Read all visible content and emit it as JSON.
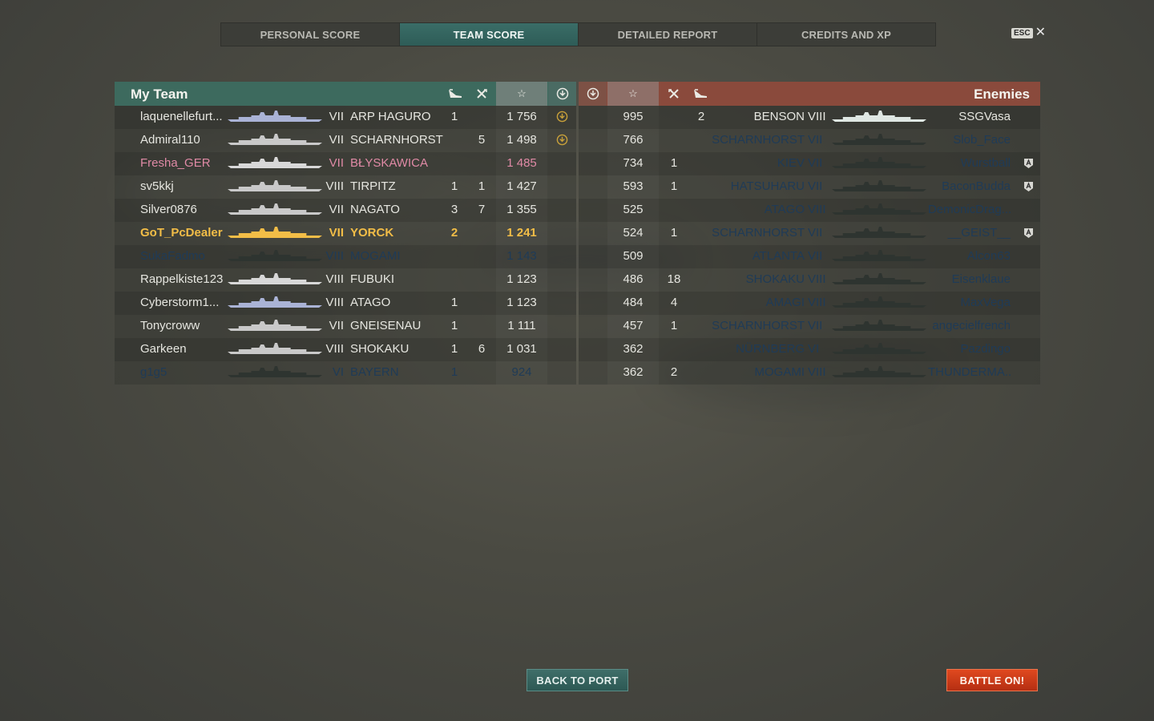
{
  "tabs": [
    {
      "label": "PERSONAL SCORE"
    },
    {
      "label": "TEAM SCORE"
    },
    {
      "label": "DETAILED REPORT"
    },
    {
      "label": "CREDITS AND XP"
    }
  ],
  "esc": {
    "key": "ESC",
    "close": "✕"
  },
  "my_team": {
    "title": "My Team",
    "rows": [
      {
        "player": "laquenellefurt...",
        "tier": "VII",
        "ship": "ARP HAGURO",
        "planes": "1",
        "ships": "",
        "xp": "1 756",
        "state": "normal",
        "medal": true,
        "hull": "#aab3d6"
      },
      {
        "player": "Admiral110",
        "tier": "VII",
        "ship": "SCHARNHORST",
        "planes": "",
        "ships": "5",
        "xp": "1 498",
        "state": "normal",
        "medal": true,
        "hull": "#c9c9c9"
      },
      {
        "player": "Fresha_GER",
        "tier": "VII",
        "ship": "BŁYSKAWICA",
        "planes": "",
        "ships": "",
        "xp": "1 485",
        "state": "pink",
        "medal": false,
        "hull": "#d8d8d8"
      },
      {
        "player": "sv5kkj",
        "tier": "VIII",
        "ship": "TIRPITZ",
        "planes": "1",
        "ships": "1",
        "xp": "1 427",
        "state": "normal",
        "medal": false,
        "hull": "#c9c9c9"
      },
      {
        "player": "Silver0876",
        "tier": "VII",
        "ship": "NAGATO",
        "planes": "3",
        "ships": "7",
        "xp": "1 355",
        "state": "normal",
        "medal": false,
        "hull": "#c9c9c9"
      },
      {
        "player": "GoT_PcDealer",
        "tier": "VII",
        "ship": "YORCK",
        "planes": "2",
        "ships": "",
        "xp": "1 241",
        "state": "me",
        "medal": false,
        "hull": "#f2bd47"
      },
      {
        "player": "SukaFadmo",
        "tier": "VIII",
        "ship": "MOGAMI",
        "planes": "",
        "ships": "",
        "xp": "1 143",
        "state": "dead",
        "medal": false,
        "hull": "#2e3430"
      },
      {
        "player": "Rappelkiste123",
        "tier": "VIII",
        "ship": "FUBUKI",
        "planes": "",
        "ships": "",
        "xp": "1 123",
        "state": "normal",
        "medal": false,
        "hull": "#d8d8d8"
      },
      {
        "player": "Cyberstorm1...",
        "tier": "VIII",
        "ship": "ATAGO",
        "planes": "1",
        "ships": "",
        "xp": "1 123",
        "state": "normal",
        "medal": false,
        "hull": "#aab3d6"
      },
      {
        "player": "Tonycroww",
        "tier": "VII",
        "ship": "GNEISENAU",
        "planes": "1",
        "ships": "",
        "xp": "1 111",
        "state": "normal",
        "medal": false,
        "hull": "#c9c9c9"
      },
      {
        "player": "Garkeen",
        "tier": "VIII",
        "ship": "SHOKAKU",
        "planes": "1",
        "ships": "6",
        "xp": "1 031",
        "state": "normal",
        "medal": false,
        "hull": "#c9c9c9"
      },
      {
        "player": "g1g5",
        "tier": "VI",
        "ship": "BAYERN",
        "planes": "1",
        "ships": "",
        "xp": "924",
        "state": "dead",
        "medal": false,
        "hull": "#2e3430"
      }
    ]
  },
  "enemies": {
    "title": "Enemies",
    "rows": [
      {
        "xp": "995",
        "ships": "",
        "planes": "2",
        "ship": "BENSON",
        "tier": "VIII",
        "player": "SSGVasa",
        "state": "normal",
        "award": false,
        "hull": "#dfe7e3"
      },
      {
        "xp": "766",
        "ships": "",
        "planes": "",
        "ship": "SCHARNHORST",
        "tier": "VII",
        "player": "Slob_Face",
        "state": "dead",
        "award": false,
        "hull": "#2e3430"
      },
      {
        "xp": "734",
        "ships": "1",
        "planes": "",
        "ship": "KIEV",
        "tier": "VII",
        "player": "Wurstball",
        "state": "dead",
        "award": true,
        "hull": "#2e3430"
      },
      {
        "xp": "593",
        "ships": "1",
        "planes": "",
        "ship": "HATSUHARU",
        "tier": "VII",
        "player": "BaconBudda",
        "state": "dead",
        "award": true,
        "hull": "#2e3430"
      },
      {
        "xp": "525",
        "ships": "",
        "planes": "",
        "ship": "ATAGO",
        "tier": "VIII",
        "player": "DemonicDrag...",
        "state": "dead",
        "award": false,
        "hull": "#2e3430"
      },
      {
        "xp": "524",
        "ships": "1",
        "planes": "",
        "ship": "SCHARNHORST",
        "tier": "VII",
        "player": "__GEIST__",
        "state": "dead",
        "award": true,
        "hull": "#2e3430"
      },
      {
        "xp": "509",
        "ships": "",
        "planes": "",
        "ship": "ATLANTA",
        "tier": "VII",
        "player": "Alcon63",
        "state": "dead",
        "award": false,
        "hull": "#2e3430"
      },
      {
        "xp": "486",
        "ships": "18",
        "planes": "",
        "ship": "SHOKAKU",
        "tier": "VIII",
        "player": "Eisenklaue",
        "state": "dead",
        "award": false,
        "hull": "#2e3430"
      },
      {
        "xp": "484",
        "ships": "4",
        "planes": "",
        "ship": "AMAGI",
        "tier": "VIII",
        "player": "MaxVega",
        "state": "dead",
        "award": false,
        "hull": "#2e3430"
      },
      {
        "xp": "457",
        "ships": "1",
        "planes": "",
        "ship": "SCHARNHORST",
        "tier": "VII",
        "player": "angecielfrench",
        "state": "dead",
        "award": false,
        "hull": "#2e3430"
      },
      {
        "xp": "362",
        "ships": "",
        "planes": "",
        "ship": "NÜRNBERG",
        "tier": "VI",
        "player": "Pazdingo",
        "state": "dead",
        "award": false,
        "hull": "#2e3430"
      },
      {
        "xp": "362",
        "ships": "2",
        "planes": "",
        "ship": "MOGAMI",
        "tier": "VIII",
        "player": "THUNDERMA...",
        "state": "dead",
        "award": false,
        "hull": "#2e3430"
      }
    ]
  },
  "buttons": {
    "back": "BACK TO PORT",
    "battle": "BATTLE ON!"
  },
  "colors": {
    "accent_team": "#3d6a5e",
    "accent_enemy": "#8a4a3c",
    "self": "#f2bd47",
    "destroyed": "#1f3b57",
    "battle_button": "#d0401b"
  }
}
